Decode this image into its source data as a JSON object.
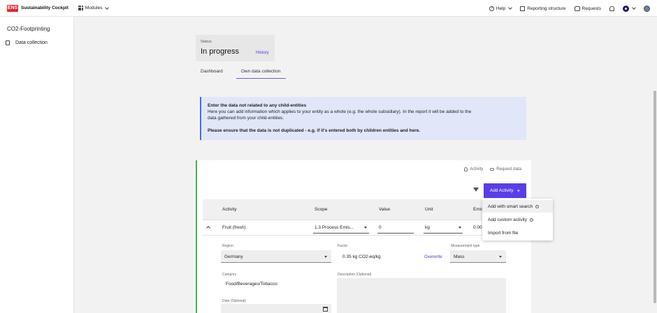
{
  "topbar": {
    "logo": "ENS",
    "brand": "Sustainability Cockpit",
    "modules": "Modules",
    "help": "Help",
    "reporting_structure": "Reporting structure",
    "requests": "Requests"
  },
  "sidebar": {
    "title": "CO2-Footprinting",
    "items": [
      {
        "label": "Data collection"
      }
    ]
  },
  "status": {
    "label": "Status",
    "value": "In progress",
    "history": "History"
  },
  "tabs": [
    {
      "label": "Dashboard"
    },
    {
      "label": "Own data collection"
    }
  ],
  "info": {
    "heading": "Enter the data not related to any child-entities",
    "line1": "Here you can add information which applies to your entity as a whole (e.g. the whole subsidiary). In the report it will be added to the",
    "line2": "data gathered from your child-entities.",
    "warning": "Please ensure that the data is not duplicated - e.g. if it's entered both by children entities and here."
  },
  "panel": {
    "activity_link": "Activity",
    "request_link": "Request data",
    "add_button": "Add Activity",
    "add_plus": "+"
  },
  "table": {
    "headers": [
      "Activity",
      "Scope",
      "Value",
      "Unit",
      "Emiss"
    ],
    "row": {
      "activity": "Fruit (fresh)",
      "scope": "1.3 Process Emis...",
      "value": "0",
      "unit": "kg",
      "emission": "0.00"
    }
  },
  "detail": {
    "region_label": "Region",
    "region_value": "Germany",
    "factor_label": "Factor",
    "factor_value": "0.35 kg CO2-eq/kg",
    "overwrite": "Overwrite",
    "measurement_label": "Measurement type",
    "measurement_value": "Mass",
    "category_label": "Category",
    "category_value": "Food/Beverages/Tobacco",
    "description_label": "Description (Optional)",
    "date_label": "Date (Optional)"
  },
  "menu": {
    "items": [
      {
        "label": "Add with smart search"
      },
      {
        "label": "Add custom activity"
      },
      {
        "label": "Import from file"
      }
    ]
  },
  "colors": {
    "accent": "#5b3de8",
    "link": "#4a3bd6",
    "logo": "#e3262f",
    "panel_border": "#4caf50",
    "info_bg": "#dfe7f9"
  }
}
